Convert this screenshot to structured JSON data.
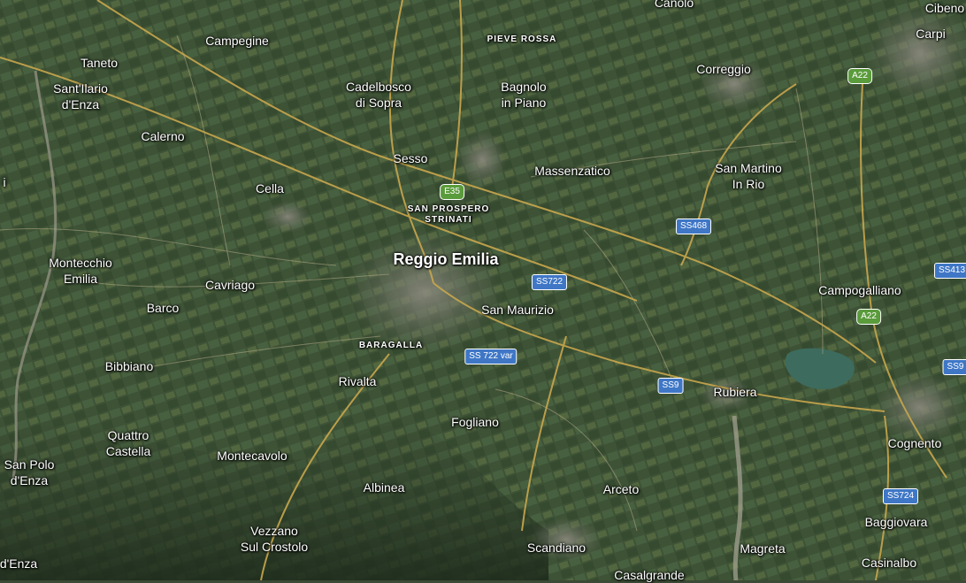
{
  "labels": [
    {
      "id": "canolo",
      "text": "Canolo"
    },
    {
      "id": "cibeno",
      "text": "Cibeno"
    },
    {
      "id": "carpi",
      "text": "Carpi"
    },
    {
      "id": "campegine",
      "text": "Campegine"
    },
    {
      "id": "pieve-rossa",
      "text": "PIEVE ROSSA"
    },
    {
      "id": "taneto",
      "text": "Taneto"
    },
    {
      "id": "correggio",
      "text": "Correggio"
    },
    {
      "id": "santilario",
      "text": "Sant'Ilario\nd'Enza"
    },
    {
      "id": "cadelbosco",
      "text": "Cadelbosco\ndi Sopra"
    },
    {
      "id": "bagnolo",
      "text": "Bagnolo\nin Piano"
    },
    {
      "id": "calerno",
      "text": "Calerno"
    },
    {
      "id": "sesso",
      "text": "Sesso"
    },
    {
      "id": "massenzatico",
      "text": "Massenzatico"
    },
    {
      "id": "san-martino",
      "text": "San Martino\nIn Rio"
    },
    {
      "id": "cella",
      "text": "Cella"
    },
    {
      "id": "san-prospero",
      "text": "SAN PROSPERO\nSTRINATI"
    },
    {
      "id": "reggio-emilia",
      "text": "Reggio Emilia"
    },
    {
      "id": "montecchio",
      "text": "Montecchio\nEmilia"
    },
    {
      "id": "cavriago",
      "text": "Cavriago"
    },
    {
      "id": "campogalliano",
      "text": "Campogalliano"
    },
    {
      "id": "barco",
      "text": "Barco"
    },
    {
      "id": "san-maurizio",
      "text": "San Maurizio"
    },
    {
      "id": "baragalla",
      "text": "BARAGALLA"
    },
    {
      "id": "bibbiano",
      "text": "Bibbiano"
    },
    {
      "id": "rivalta",
      "text": "Rivalta"
    },
    {
      "id": "rubiera",
      "text": "Rubiera"
    },
    {
      "id": "fogliano",
      "text": "Fogliano"
    },
    {
      "id": "quattro-castella",
      "text": "Quattro\nCastella"
    },
    {
      "id": "cognento",
      "text": "Cognento"
    },
    {
      "id": "san-polo",
      "text": "San Polo\nd'Enza"
    },
    {
      "id": "montecavolo",
      "text": "Montecavolo"
    },
    {
      "id": "albinea",
      "text": "Albinea"
    },
    {
      "id": "arceto",
      "text": "Arceto"
    },
    {
      "id": "baggiovara",
      "text": "Baggiovara"
    },
    {
      "id": "vezzano",
      "text": "Vezzano\nSul Crostolo"
    },
    {
      "id": "scandiano",
      "text": "Scandiano"
    },
    {
      "id": "magreta",
      "text": "Magreta"
    },
    {
      "id": "enza",
      "text": "d'Enza"
    },
    {
      "id": "casinalbo",
      "text": "Casinalbo"
    },
    {
      "id": "casalgrande",
      "text": "Casalgrande"
    },
    {
      "id": "edge-i",
      "text": "i"
    }
  ],
  "shields": [
    {
      "id": "a22-top",
      "text": "A22",
      "color": "green"
    },
    {
      "id": "e35",
      "text": "E35",
      "color": "green"
    },
    {
      "id": "ss468",
      "text": "SS468",
      "color": "blue"
    },
    {
      "id": "ss413",
      "text": "SS413",
      "color": "blue"
    },
    {
      "id": "ss722",
      "text": "SS722",
      "color": "blue"
    },
    {
      "id": "a22-mid",
      "text": "A22",
      "color": "green"
    },
    {
      "id": "ss722var",
      "text": "SS 722 var",
      "color": "blue"
    },
    {
      "id": "ss9-right",
      "text": "SS9",
      "color": "blue"
    },
    {
      "id": "ss9",
      "text": "SS9",
      "color": "blue"
    },
    {
      "id": "ss724",
      "text": "SS724",
      "color": "blue"
    }
  ]
}
